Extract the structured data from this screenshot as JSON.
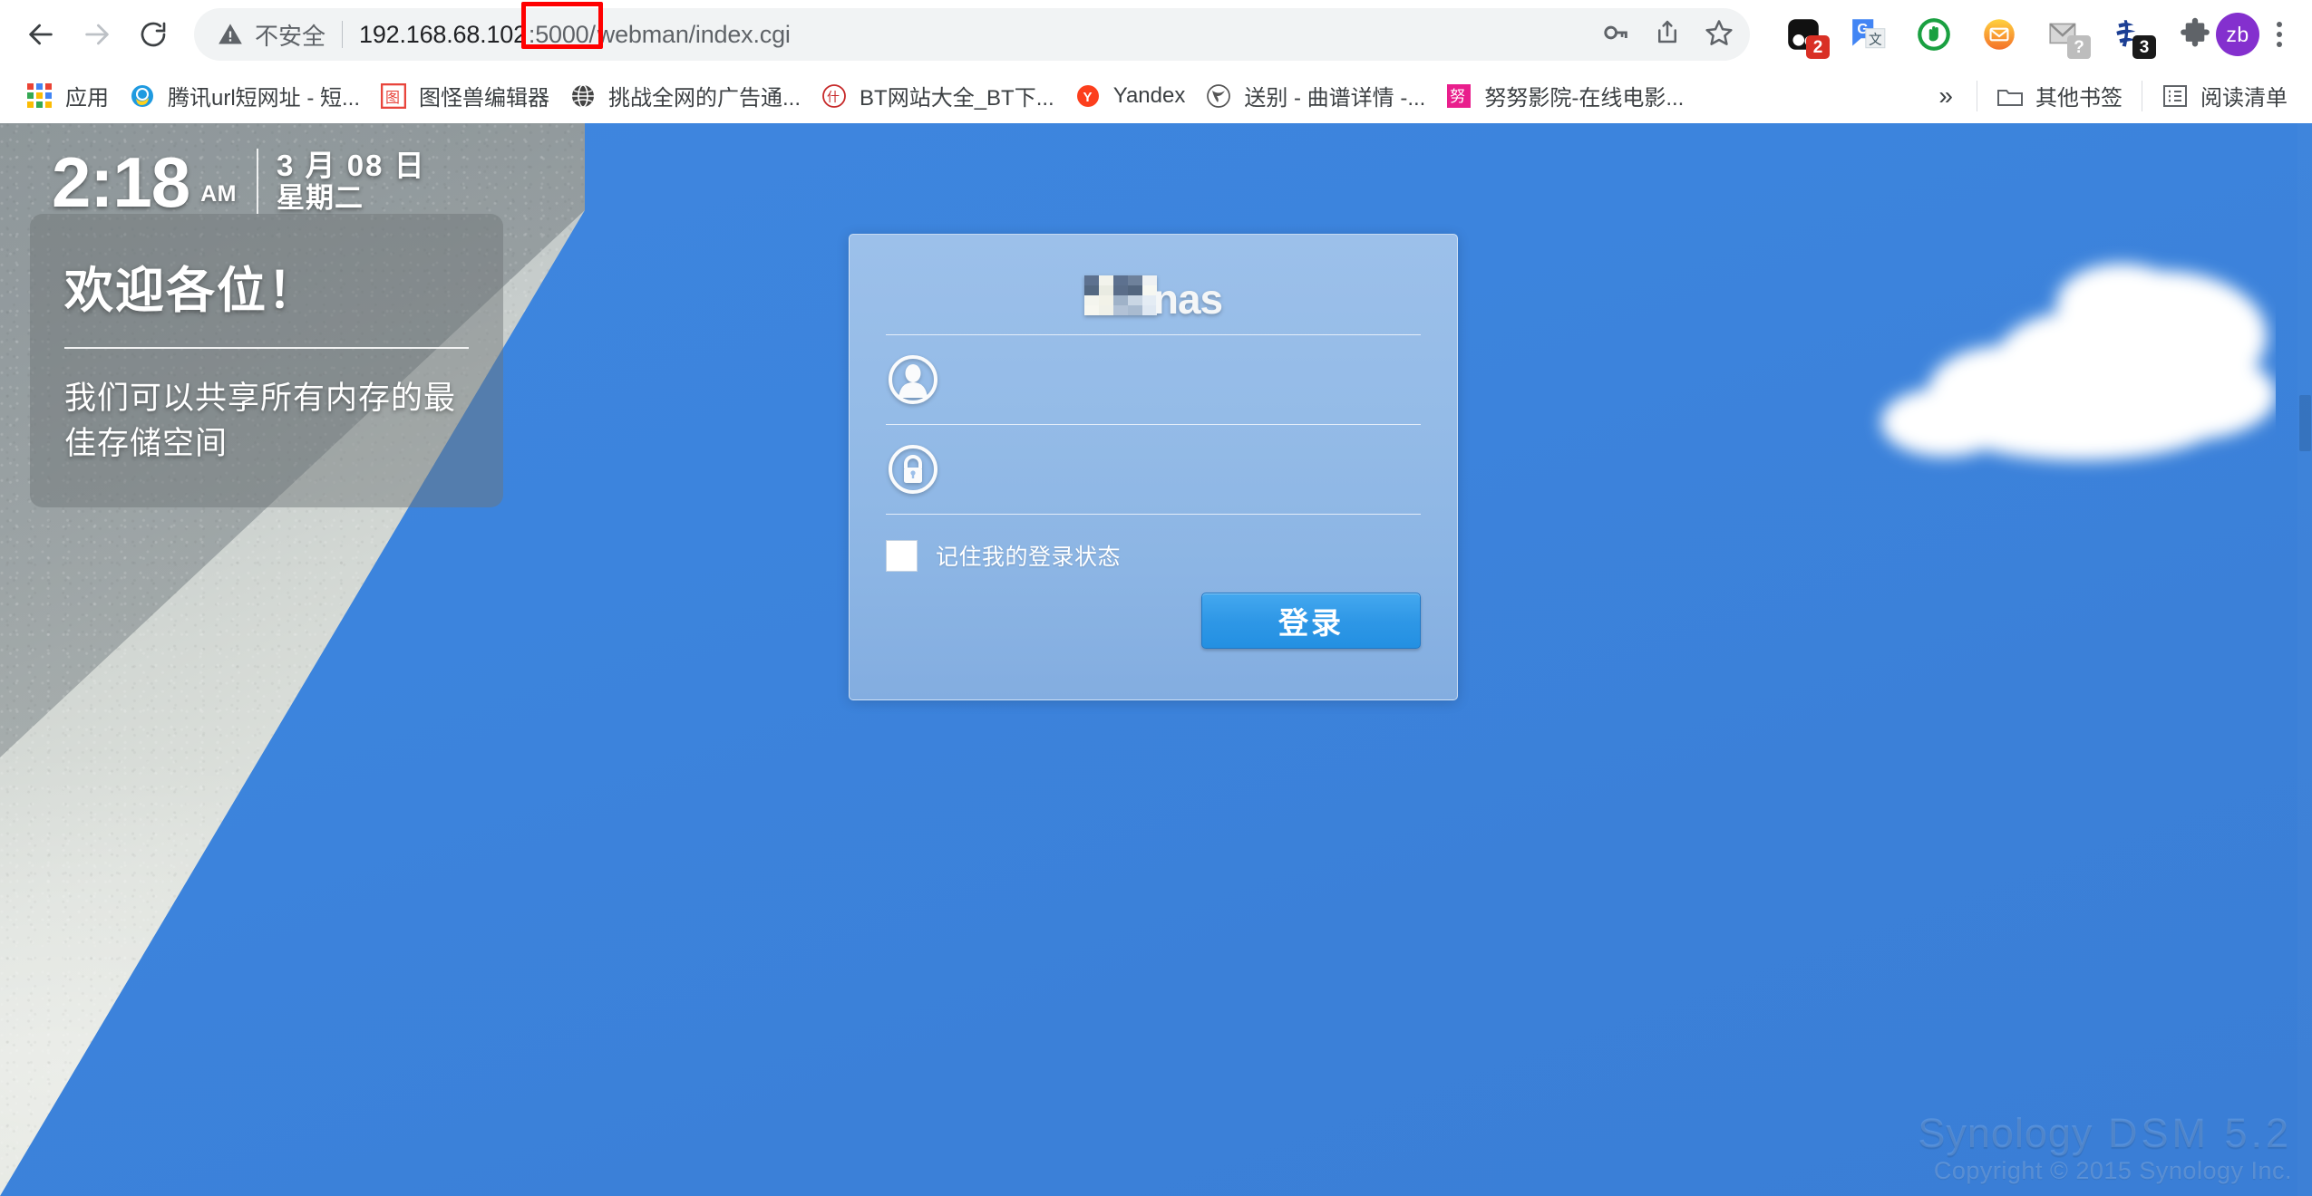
{
  "browser": {
    "nav": {
      "back_label": "Back",
      "forward_label": "Forward",
      "reload_label": "Reload"
    },
    "omnibox": {
      "security_icon": "warning-triangle-icon",
      "security_label": "不安全",
      "url_host": "192.168.68.102",
      "url_port": ":5000/",
      "url_path": "webman/index.cgi",
      "full_url": "192.168.68.102:5000/webman/index.cgi",
      "annotation_color": "#ff0000",
      "icons": [
        {
          "name": "password-key-icon",
          "glyph": "key"
        },
        {
          "name": "share-icon",
          "glyph": "share"
        },
        {
          "name": "bookmark-star-icon",
          "glyph": "star"
        }
      ]
    },
    "extensions": [
      {
        "name": "adblock-extension-icon",
        "badge": "2",
        "badge_color": "#d93025"
      },
      {
        "name": "google-translate-extension-icon",
        "badge": ""
      },
      {
        "name": "stop-hand-extension-icon",
        "badge": ""
      },
      {
        "name": "mail-extension-icon",
        "badge": ""
      },
      {
        "name": "gmail-checker-extension-icon",
        "badge": "?",
        "badge_color": "#bdbdbd"
      },
      {
        "name": "calligraphy-extension-icon",
        "badge": "3",
        "badge_color": "#1a1a1a"
      },
      {
        "name": "extensions-puzzle-icon",
        "badge": ""
      }
    ],
    "profile": {
      "initials": "zb",
      "color": "#8430ce"
    },
    "menu_label": "Chrome menu",
    "bookmarks": [
      {
        "label": "应用",
        "icon": "apps-grid-icon"
      },
      {
        "label": "腾讯url短网址 - 短...",
        "icon": "qq-favicon"
      },
      {
        "label": "图怪兽编辑器",
        "icon": "tuguaishou-favicon"
      },
      {
        "label": "挑战全网的广告通...",
        "icon": "globe-favicon"
      },
      {
        "label": "BT网站大全_BT下...",
        "icon": "bt-favicon"
      },
      {
        "label": "Yandex",
        "icon": "yandex-favicon"
      },
      {
        "label": "送别 - 曲谱详情 -...",
        "icon": "music-favicon"
      },
      {
        "label": "努努影院-在线电影...",
        "icon": "nunu-favicon"
      }
    ],
    "bookmarks_overflow_label": "»",
    "other_bookmarks_label": "其他书签",
    "other_bookmarks_icon": "folder-icon",
    "reading_list_label": "阅读清单",
    "reading_list_icon": "reading-list-icon"
  },
  "page": {
    "clock": {
      "time": "2:18",
      "ampm": "AM",
      "date": "3 月 08 日",
      "weekday": "星期二"
    },
    "welcome": {
      "title": "欢迎各位！",
      "description": "我们可以共享所有内存的最佳存储空间"
    },
    "login": {
      "logo_text": "nas",
      "logo_prefix_hidden": true,
      "username": {
        "value": "",
        "placeholder": "",
        "icon": "user-avatar-icon"
      },
      "password": {
        "value": "",
        "placeholder": "",
        "icon": "lock-icon"
      },
      "remember_label": "记住我的登录状态",
      "remember_checked": false,
      "submit_label": "登录",
      "submit_color": "#2e97e6"
    },
    "footer": {
      "brand": "Synology",
      "product": "DSM 5.2",
      "copyright": "Copyright © 2015 Synology Inc."
    },
    "background": {
      "sky_color": "#3c86e0",
      "cloud": "cumulus-cloud",
      "wall": "concrete-wall-photo"
    }
  }
}
